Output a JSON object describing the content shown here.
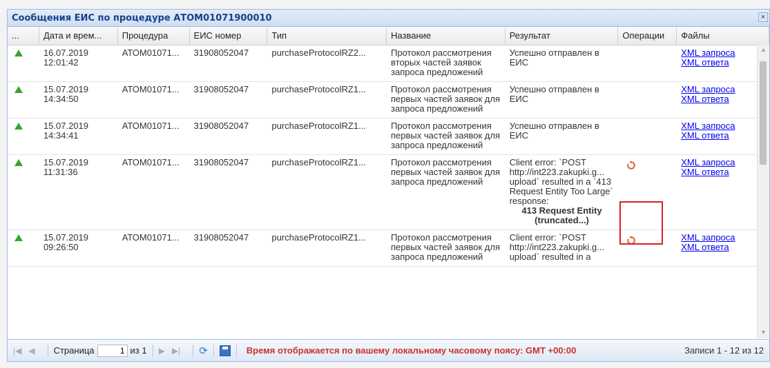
{
  "window": {
    "title": "Сообщения ЕИС по процедуре АТОМ01071900010",
    "close_label": "×"
  },
  "columns": [
    "...",
    "Дата и врем...",
    "Процедура",
    "ЕИС номер",
    "Тип",
    "Название",
    "Результат",
    "Операции",
    "Файлы"
  ],
  "rows": [
    {
      "date": "16.07.2019 12:01:42",
      "procedure": "АТОМ01071...",
      "eis": "31908052047",
      "type": "purchaseProtocolRZ2...",
      "name": "Протокол рассмотрения вторых частей заявок запроса предложений",
      "result": "Успешно отправлен в ЕИС",
      "result_bold": "",
      "has_retry": false,
      "file_req": "XML запроса",
      "file_resp": "XML ответа"
    },
    {
      "date": "15.07.2019 14:34:50",
      "procedure": "АТОМ01071...",
      "eis": "31908052047",
      "type": "purchaseProtocolRZ1...",
      "name": "Протокол рассмотрения первых частей заявок для запроса предложений",
      "result": "Успешно отправлен в ЕИС",
      "result_bold": "",
      "has_retry": false,
      "file_req": "XML запроса",
      "file_resp": "XML ответа"
    },
    {
      "date": "15.07.2019 14:34:41",
      "procedure": "АТОМ01071...",
      "eis": "31908052047",
      "type": "purchaseProtocolRZ1...",
      "name": "Протокол рассмотрения первых частей заявок для запроса предложений",
      "result": "Успешно отправлен в ЕИС",
      "result_bold": "",
      "has_retry": false,
      "file_req": "XML запроса",
      "file_resp": "XML ответа"
    },
    {
      "date": "15.07.2019 11:31:36",
      "procedure": "АТОМ01071...",
      "eis": "31908052047",
      "type": "purchaseProtocolRZ1...",
      "name": "Протокол рассмотрения первых частей заявок для запроса предложений",
      "result": "Client error: `POST http://int223.zakupki.g... upload` resulted in a `413 Request Entity Too Large` response:",
      "result_bold": "413 Request Entity (truncated...)",
      "has_retry": true,
      "file_req": "XML запроса",
      "file_resp": "XML ответа"
    },
    {
      "date": "15.07.2019 09:26:50",
      "procedure": "АТОМ01071...",
      "eis": "31908052047",
      "type": "purchaseProtocolRZ1...",
      "name": "Протокол рассмотрения первых частей заявок для запроса предложений",
      "result": "Client error: `POST http://int223.zakupki.g... upload` resulted in a",
      "result_bold": "",
      "has_retry": true,
      "file_req": "XML запроса",
      "file_resp": "XML ответа"
    }
  ],
  "pager": {
    "page_label": "Страница",
    "page_value": "1",
    "of_label": "из 1",
    "timezone_msg": "Время отображается по вашему локальному часовому поясу: GMT +00:00",
    "records_label": "Записи 1 - 12 из 12"
  },
  "colors": {
    "accent": "#15428b",
    "success": "#3aa335",
    "error": "#c8332b",
    "retry": "#e05a2a",
    "highlight": "#d9202a"
  },
  "icons": {
    "row_status": "green-up-triangle-icon",
    "retry": "retry-icon",
    "refresh": "refresh-icon",
    "save": "save-icon"
  }
}
